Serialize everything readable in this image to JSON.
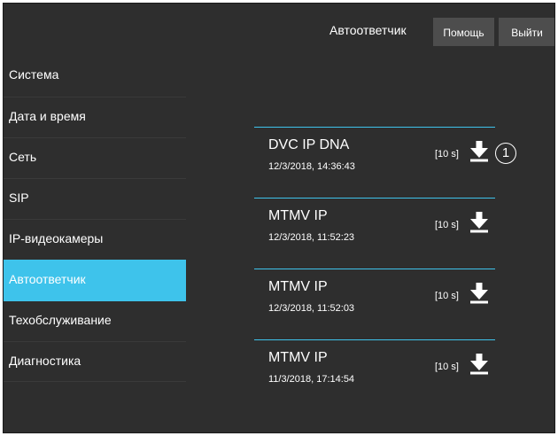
{
  "header": {
    "title": "Автоответчик",
    "help_label": "Помощь",
    "logout_label": "Выйти"
  },
  "sidebar": {
    "items": [
      {
        "label": "Система"
      },
      {
        "label": "Дата и время"
      },
      {
        "label": "Сеть"
      },
      {
        "label": "SIP"
      },
      {
        "label": "IP-видеокамеры"
      },
      {
        "label": "Автоответчик",
        "active": true
      },
      {
        "label": "Техобслуживание"
      },
      {
        "label": "Диагностика"
      }
    ]
  },
  "messages": [
    {
      "name": "DVC IP DNA",
      "date": "12/3/2018, 14:36:43",
      "duration": "[10 s]",
      "icon": "download-icon"
    },
    {
      "name": "MTMV IP",
      "date": "12/3/2018, 11:52:23",
      "duration": "[10 s]",
      "icon": "download-icon"
    },
    {
      "name": "MTMV IP",
      "date": "12/3/2018, 11:52:03",
      "duration": "[10 s]",
      "icon": "download-icon"
    },
    {
      "name": "MTMV IP",
      "date": "11/3/2018, 17:14:54",
      "duration": "[10 s]",
      "icon": "download-icon"
    }
  ],
  "callout": {
    "label": "1"
  },
  "colors": {
    "background": "#2e2e2e",
    "accent": "#3ec3eb",
    "button": "#4d4d4d",
    "text": "#ffffff"
  }
}
